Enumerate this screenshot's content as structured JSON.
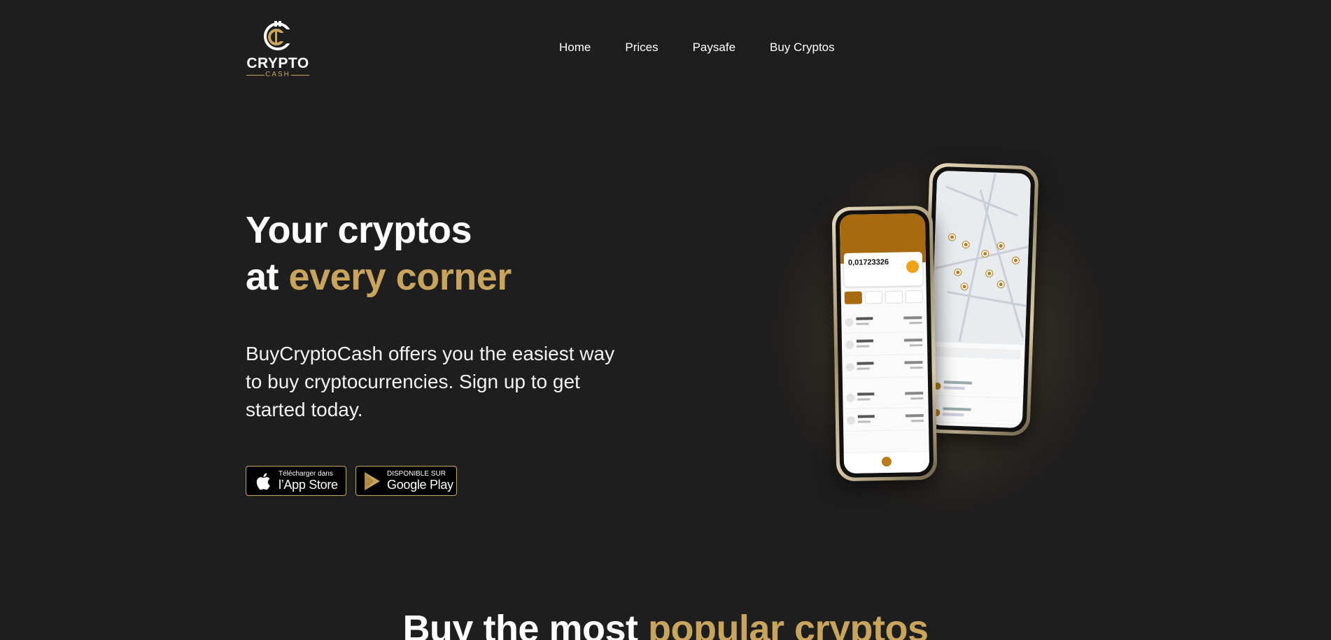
{
  "brand": {
    "name": "CRYPTO",
    "sub": "CASH",
    "accent_color": "#c9a45c",
    "background_color": "#1f1e1e"
  },
  "nav": {
    "items": [
      {
        "label": "Home"
      },
      {
        "label": "Prices"
      },
      {
        "label": "Paysafe"
      },
      {
        "label": "Buy Cryptos"
      }
    ]
  },
  "hero": {
    "title_line1": "Your cryptos",
    "title_line2_prefix": "at ",
    "title_line2_highlight": "every corner",
    "description": "BuyCryptoCash offers you the easiest way to buy cryptocurrencies. Sign up to get started today.",
    "app_store": {
      "small": "Télécharger dans",
      "big": "l’App Store",
      "icon": "apple-icon"
    },
    "google_play": {
      "small": "DISPONIBLE SUR",
      "big": "Google Play",
      "icon": "play-icon"
    }
  },
  "phone_app": {
    "wallet_amount": "0,01723326"
  },
  "section": {
    "title_prefix": "Buy the most ",
    "title_highlight": "popular cryptos"
  }
}
